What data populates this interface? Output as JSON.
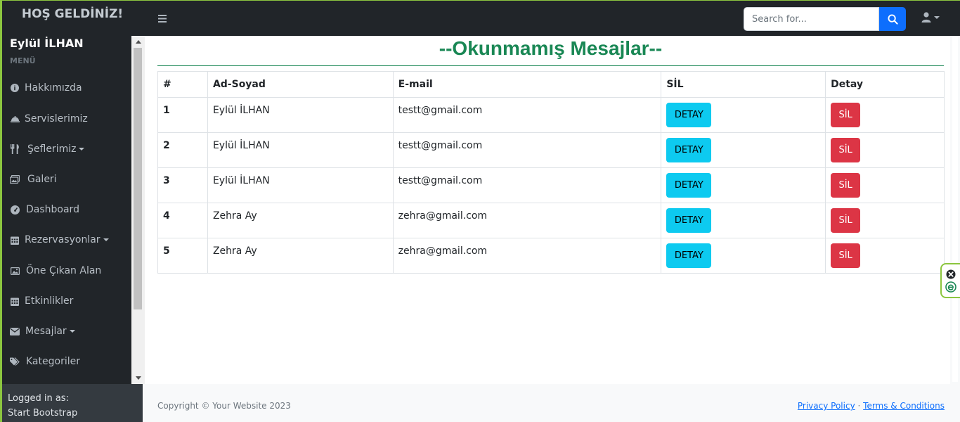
{
  "brand": {
    "title": "HOŞ GELDİNİZ!"
  },
  "navbar": {
    "search": {
      "placeholder": "Search for..."
    }
  },
  "sidebar": {
    "user_name": "Eylül İLHAN",
    "menu_heading": "MENÜ",
    "items": [
      {
        "label": "Hakkımızda",
        "icon": "info-circle-icon",
        "dropdown": false
      },
      {
        "label": "Servislerimiz",
        "icon": "bell-concierge-icon",
        "dropdown": false
      },
      {
        "label": "Şeflerimiz",
        "icon": "utensils-icon",
        "dropdown": true
      },
      {
        "label": "Galeri",
        "icon": "images-icon",
        "dropdown": false
      },
      {
        "label": "Dashboard",
        "icon": "gauge-icon",
        "dropdown": false
      },
      {
        "label": "Rezervasyonlar",
        "icon": "calendar-icon",
        "dropdown": true
      },
      {
        "label": "Öne Çıkan Alan",
        "icon": "image-icon",
        "dropdown": false
      },
      {
        "label": "Etkinlikler",
        "icon": "calendar-icon",
        "dropdown": false
      },
      {
        "label": "Mesajlar",
        "icon": "envelope-icon",
        "dropdown": true
      },
      {
        "label": "Kategoriler",
        "icon": "tags-icon",
        "dropdown": false
      }
    ],
    "footer": {
      "logged_in_label": "Logged in as:",
      "user": "Start Bootstrap"
    }
  },
  "main": {
    "title": "--Okunmamış Mesajlar--",
    "table": {
      "headers": [
        "#",
        "Ad-Soyad",
        "E-mail",
        "SİL",
        "Detay"
      ],
      "rows": [
        {
          "num": "1",
          "name": "Eylül İLHAN",
          "email": "testt@gmail.com",
          "detail_label": "DETAY",
          "delete_label": "SİL"
        },
        {
          "num": "2",
          "name": "Eylül İLHAN",
          "email": "testt@gmail.com",
          "detail_label": "DETAY",
          "delete_label": "SİL"
        },
        {
          "num": "3",
          "name": "Eylül İLHAN",
          "email": "testt@gmail.com",
          "detail_label": "DETAY",
          "delete_label": "SİL"
        },
        {
          "num": "4",
          "name": "Zehra Ay",
          "email": "zehra@gmail.com",
          "detail_label": "DETAY",
          "delete_label": "SİL"
        },
        {
          "num": "5",
          "name": "Zehra Ay",
          "email": "zehra@gmail.com",
          "detail_label": "DETAY",
          "delete_label": "SİL"
        }
      ]
    }
  },
  "footer": {
    "copyright": "Copyright © Your Website 2023",
    "separator": "·",
    "privacy": "Privacy Policy",
    "terms": "Terms & Conditions"
  },
  "colors": {
    "nav_bg": "#212529",
    "accent_green": "#198754",
    "frame_green": "#8cc63f",
    "primary": "#0d6efd",
    "info": "#0dcaf0",
    "danger": "#dc3545"
  }
}
